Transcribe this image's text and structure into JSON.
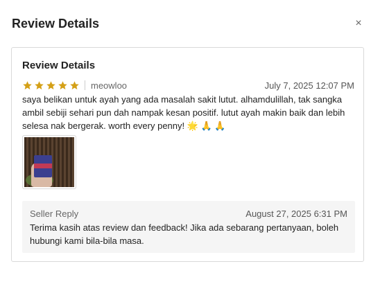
{
  "modal": {
    "title": "Review Details",
    "close_icon": "close-icon",
    "close_glyph": "×"
  },
  "card": {
    "title": "Review Details",
    "rating": 5,
    "rating_max": 5,
    "star_color": "#d4a017",
    "username": "meowloo",
    "date": "July 7, 2025 12:07 PM",
    "text": "saya belikan untuk ayah yang ada masalah sakit lutut. alhamdulillah, tak sangka ambil sebiji sehari pun dah nampak kesan positif. lutut ayah makin baik dan lebih selesa nak bergerak. worth every penny!",
    "emojis": [
      "🌟",
      "🙏",
      "🙏"
    ],
    "image_icon": "review-photo"
  },
  "seller_reply": {
    "label": "Seller Reply",
    "date": "August 27, 2025 6:31 PM",
    "text": "Terima kasih atas review dan feedback! Jika ada sebarang pertanyaan, boleh hubungi kami bila-bila masa."
  }
}
